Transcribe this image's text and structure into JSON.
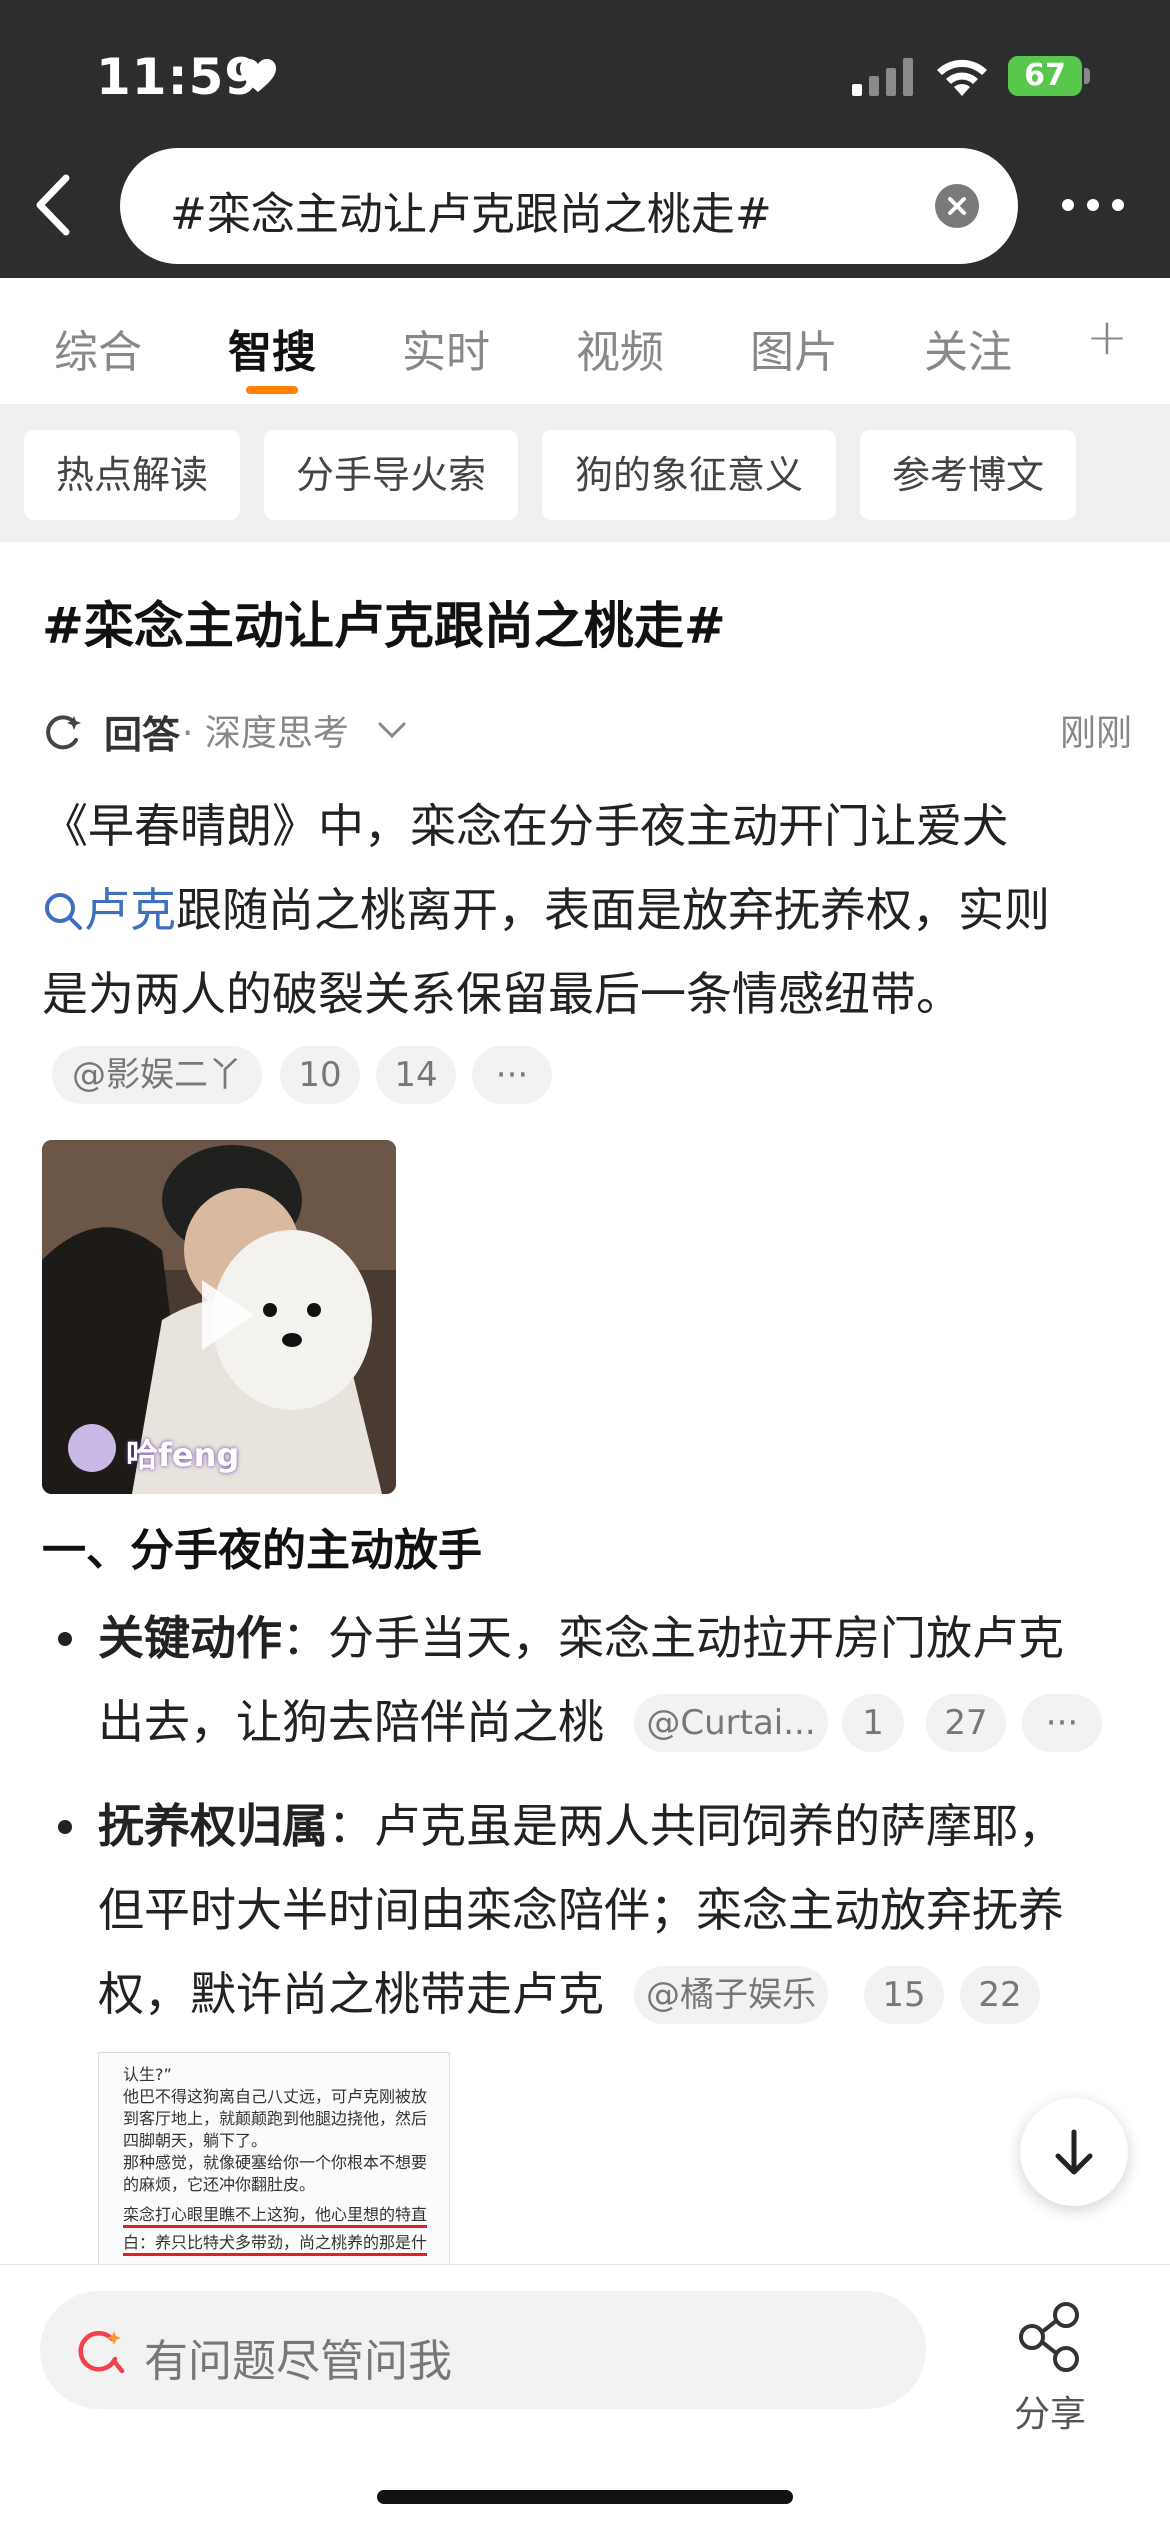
{
  "status_bar": {
    "time": "11:59",
    "battery": "67"
  },
  "search": {
    "query": "#栾念主动让卢克跟尚之桃走#"
  },
  "tabs": [
    {
      "label": "综合"
    },
    {
      "label": "智搜"
    },
    {
      "label": "实时"
    },
    {
      "label": "视频"
    },
    {
      "label": "图片"
    },
    {
      "label": "关注"
    }
  ],
  "tabs_plus": "+",
  "chips": [
    {
      "label": "热点解读"
    },
    {
      "label": "分手导火索"
    },
    {
      "label": "狗的象征意义"
    },
    {
      "label": "参考博文"
    }
  ],
  "content": {
    "title": "#栾念主动让卢克跟尚之桃走#",
    "answer_label": "回答",
    "answer_mode": "· 深度思考",
    "answer_time": "刚刚",
    "para1_line1": "《早春晴朗》中，栾念在分手夜主动开门让爱犬",
    "para1_link": "卢克",
    "para1_line2_rest": "跟随尚之桃离开，表面是放弃抚养权，实则",
    "para1_line3": "是为两人的破裂关系保留最后一条情感纽带。",
    "meta1": {
      "source": "@影娱二丫",
      "count1": "10",
      "count2": "14",
      "more": "···"
    },
    "video_caption": "哈feng",
    "section_title": "一、分手夜的主动放手",
    "bullet1": {
      "label": "关键动作",
      "line1_rest": "：分手当天，栾念主动拉开房门放卢克",
      "line2": "出去，让狗去陪伴尚之桃",
      "source": "@Curtai...",
      "count1": "1",
      "count2": "27",
      "more": "···"
    },
    "bullet2": {
      "label": "抚养权归属",
      "line1_rest": "：卢克虽是两人共同饲养的萨摩耶，",
      "line2": "但平时大半时间由栾念陪伴；栾念主动放弃抚养",
      "line3": "权，默许尚之桃带走卢克",
      "source": "@橘子娱乐",
      "count1": "15",
      "count2": "22"
    },
    "doc_lines": [
      "认生?”",
      "他巴不得这狗离自己八丈远，可卢克刚被放",
      "到客厅地上，就颠颠跑到他腿边挠他，然后",
      "四脚朝天，躺下了。",
      "那种感觉，就像硬塞给你一个你根本不想要",
      "的麻烦，它还冲你翻肚皮。",
      "栾念打心眼里瞧不上这狗，他心里想的特直",
      "白：养只比特犬多带劲，尚之桃养的那是什"
    ]
  },
  "bottom": {
    "ask_placeholder": "有问题尽管问我",
    "share_label": "分享"
  },
  "colors": {
    "accent": "#ff8200",
    "link": "#3f70c0",
    "battery": "#58c84d"
  }
}
